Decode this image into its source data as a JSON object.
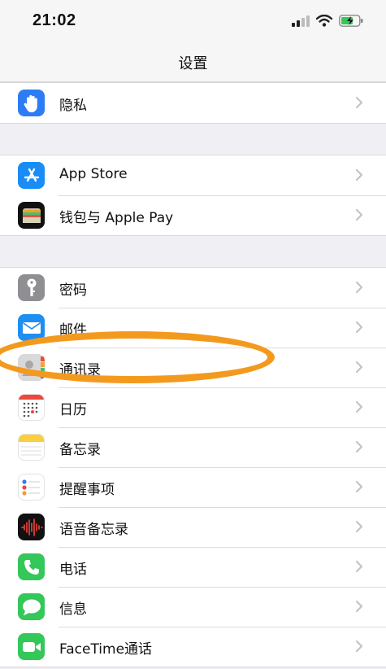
{
  "status": {
    "time": "21:02"
  },
  "nav": {
    "title": "设置"
  },
  "groups": [
    {
      "items": [
        {
          "label": "隐私",
          "icon": "hand-icon"
        }
      ]
    },
    {
      "items": [
        {
          "label": "App Store",
          "icon": "app-store-icon"
        },
        {
          "label": "钱包与 Apple Pay",
          "icon": "wallet-icon"
        }
      ]
    },
    {
      "items": [
        {
          "label": "密码",
          "icon": "key-icon"
        },
        {
          "label": "邮件",
          "icon": "mail-icon"
        },
        {
          "label": "通讯录",
          "icon": "contacts-icon"
        },
        {
          "label": "日历",
          "icon": "calendar-icon"
        },
        {
          "label": "备忘录",
          "icon": "notes-icon"
        },
        {
          "label": "提醒事项",
          "icon": "reminders-icon"
        },
        {
          "label": "语音备忘录",
          "icon": "voice-memos-icon"
        },
        {
          "label": "电话",
          "icon": "phone-icon"
        },
        {
          "label": "信息",
          "icon": "messages-icon"
        },
        {
          "label": "FaceTime通话",
          "icon": "facetime-icon"
        }
      ]
    }
  ],
  "annotation": {
    "color": "#f39a1e",
    "highlighted_item": "通讯录"
  }
}
